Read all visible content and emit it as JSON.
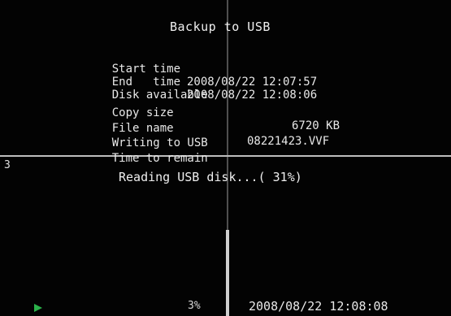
{
  "dialog": {
    "title": "Backup to USB",
    "rows": [
      {
        "label": "Start time",
        "value": "2008/08/22 12:07:57"
      },
      {
        "label": "End   time",
        "value": "2008/08/22 12:08:06"
      },
      {
        "label": "Disk available",
        "value": ""
      },
      {
        "label": "Copy size",
        "value": "6720 KB"
      },
      {
        "label": "File name",
        "value": "08221423.VVF"
      },
      {
        "label": "Writing to USB",
        "value": ""
      },
      {
        "label": "Time to remain",
        "value": ""
      }
    ]
  },
  "overlay": {
    "channel": "3",
    "status": "Reading USB disk...( 31%)",
    "progress_percent": 31
  },
  "statusbar": {
    "percent": "3%",
    "datetime": "2008/08/22 12:08:08",
    "play_icon_color": "#2bb14a"
  }
}
